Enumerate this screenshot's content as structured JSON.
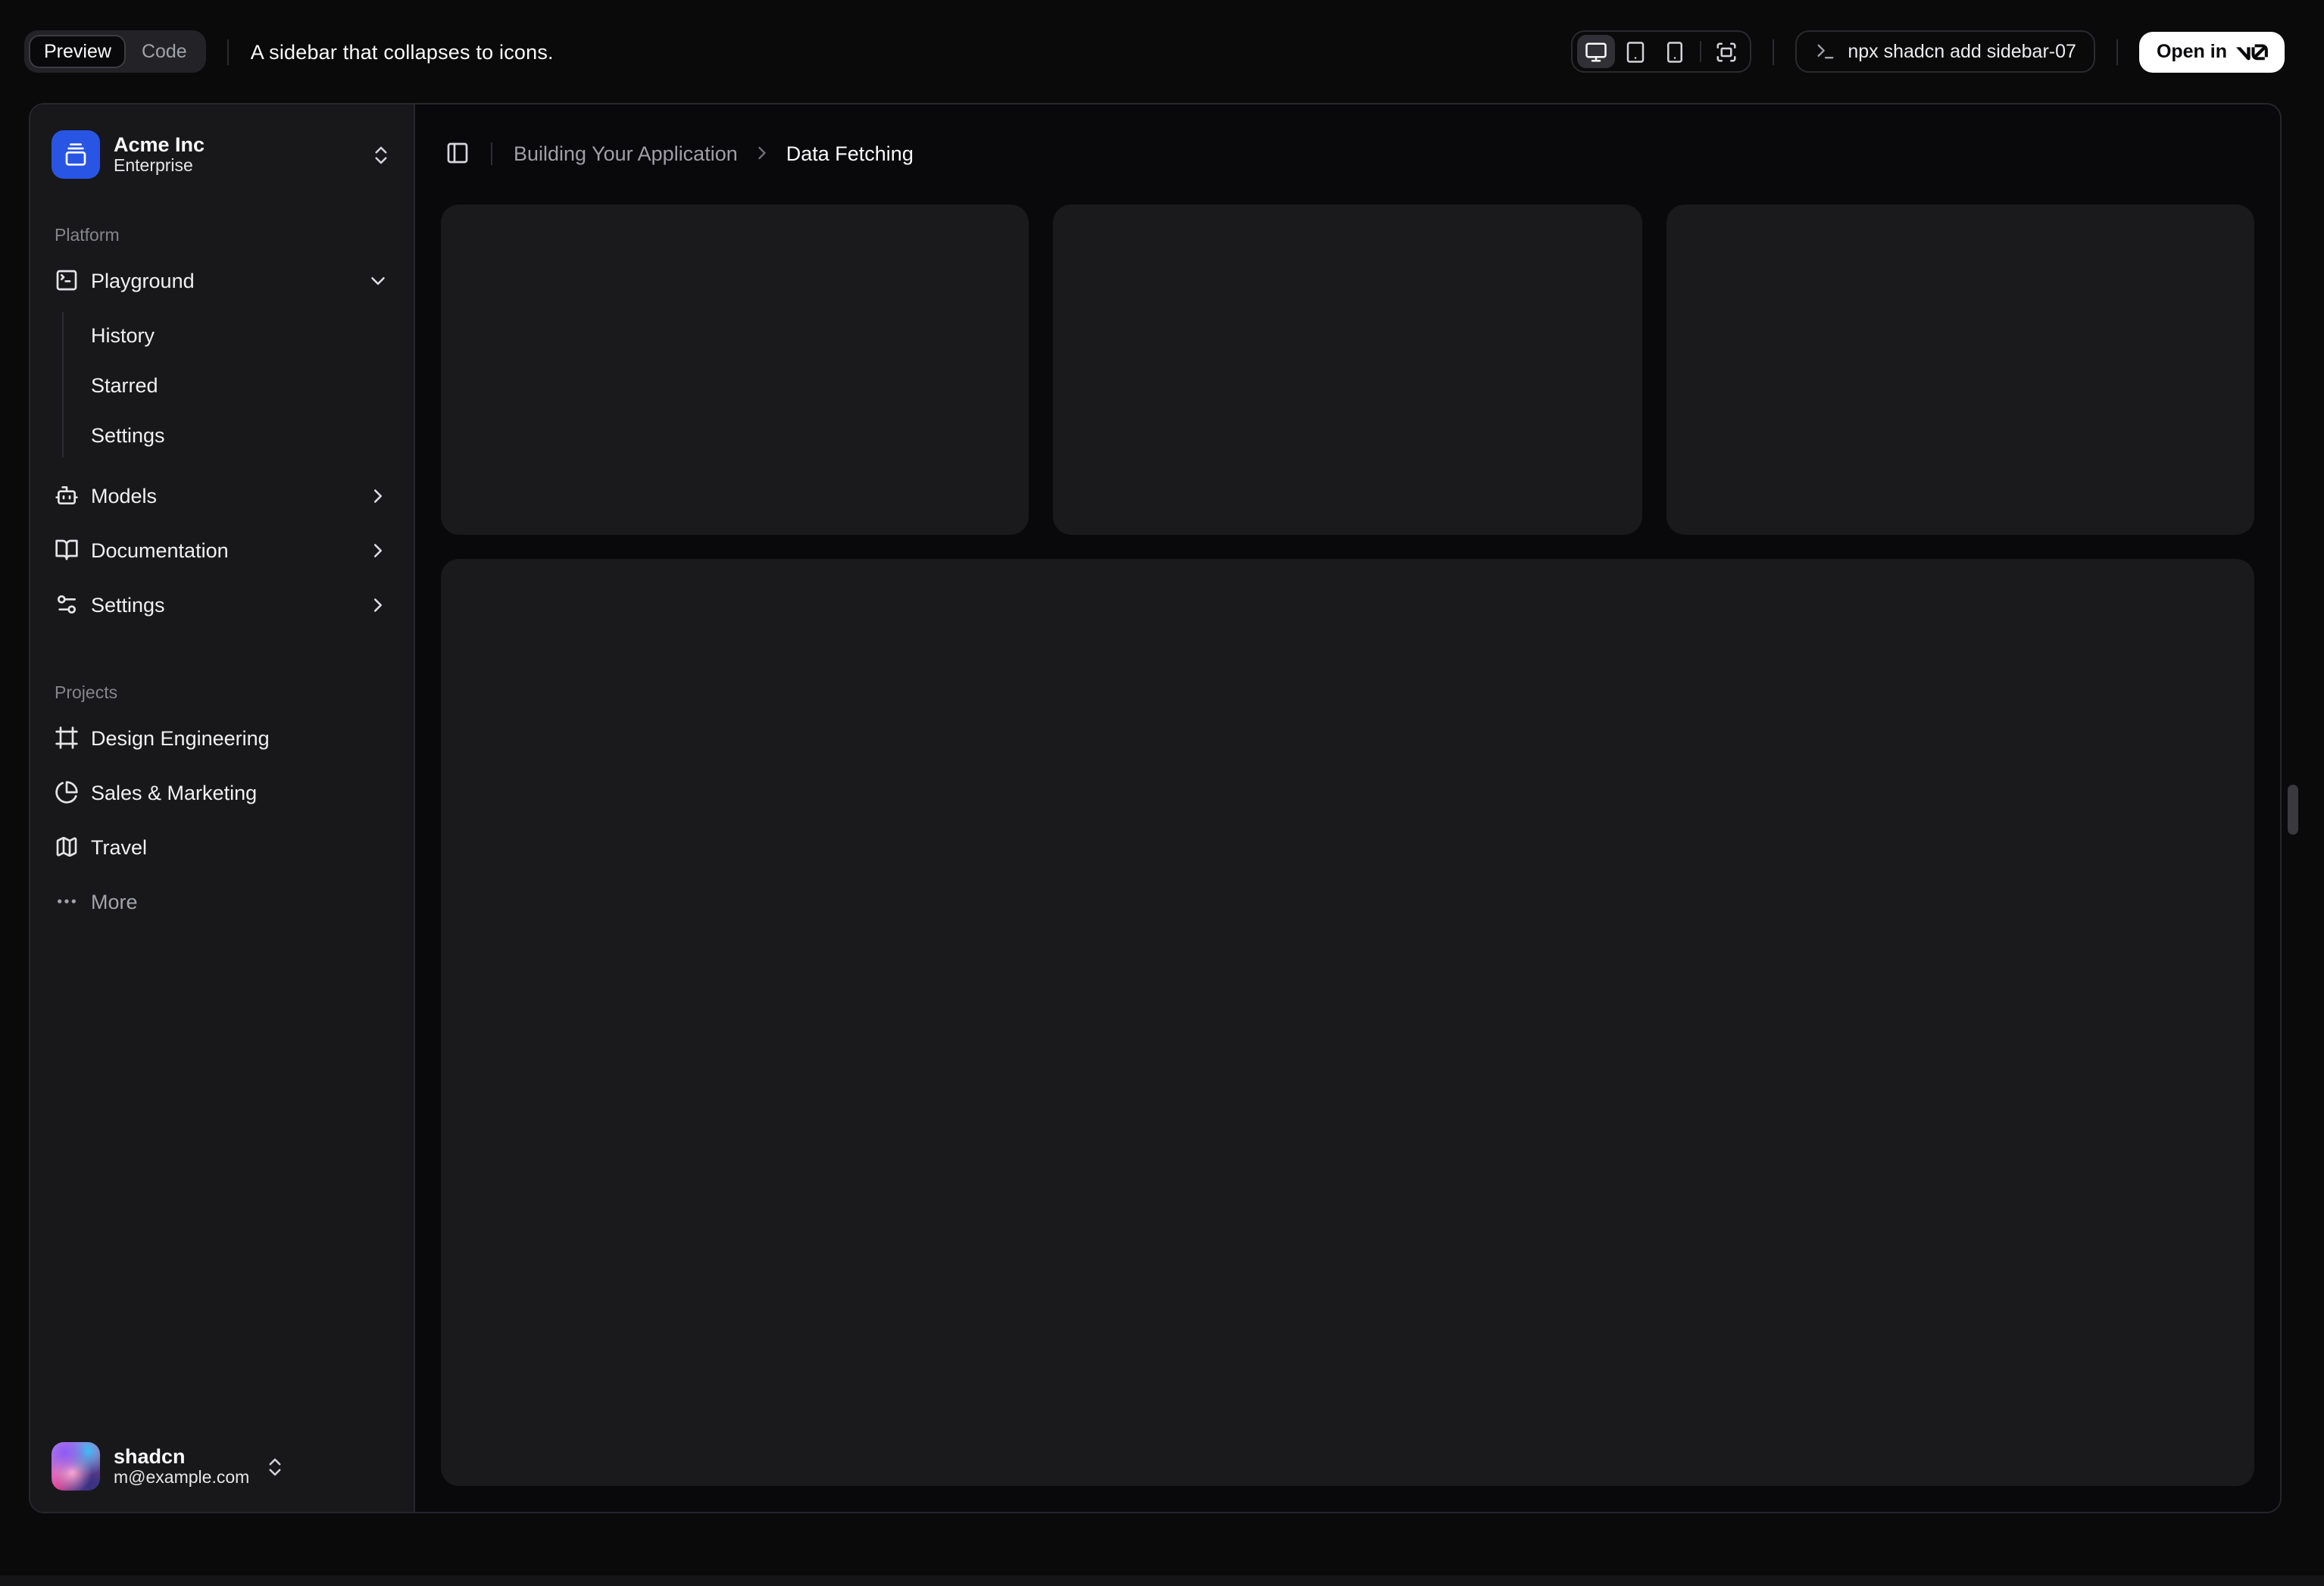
{
  "toolbar": {
    "tabs": [
      {
        "label": "Preview",
        "active": true
      },
      {
        "label": "Code",
        "active": false
      }
    ],
    "description": "A sidebar that collapses to icons.",
    "devices": [
      {
        "name": "desktop",
        "active": true
      },
      {
        "name": "tablet",
        "active": false
      },
      {
        "name": "phone",
        "active": false
      },
      {
        "name": "fullscreen",
        "active": false
      }
    ],
    "command": "npx shadcn add sidebar-07",
    "open_in": {
      "label": "Open in",
      "logo": "v0"
    }
  },
  "sidebar": {
    "team": {
      "name": "Acme Inc",
      "plan": "Enterprise"
    },
    "groups": [
      {
        "label": "Platform",
        "items": [
          {
            "label": "Playground",
            "icon": "square-terminal-icon",
            "expanded": true,
            "children": [
              {
                "label": "History"
              },
              {
                "label": "Starred"
              },
              {
                "label": "Settings"
              }
            ]
          },
          {
            "label": "Models",
            "icon": "bot-icon"
          },
          {
            "label": "Documentation",
            "icon": "book-open-icon"
          },
          {
            "label": "Settings",
            "icon": "sliders-icon"
          }
        ]
      },
      {
        "label": "Projects",
        "items": [
          {
            "label": "Design Engineering",
            "icon": "frame-icon"
          },
          {
            "label": "Sales & Marketing",
            "icon": "pie-chart-icon"
          },
          {
            "label": "Travel",
            "icon": "map-icon"
          },
          {
            "label": "More",
            "icon": "ellipsis-icon"
          }
        ]
      }
    ],
    "user": {
      "name": "shadcn",
      "email": "m@example.com"
    }
  },
  "main": {
    "breadcrumb": {
      "parent": "Building Your Application",
      "current": "Data Fetching"
    },
    "placeholder_cards": 3
  },
  "colors": {
    "team_logo_bg": "#2955e4",
    "open_in_bg": "#ffffff",
    "sidebar_bg": "#18181b",
    "content_bg": "#09090b",
    "card_bg": "#1a1a1d"
  }
}
